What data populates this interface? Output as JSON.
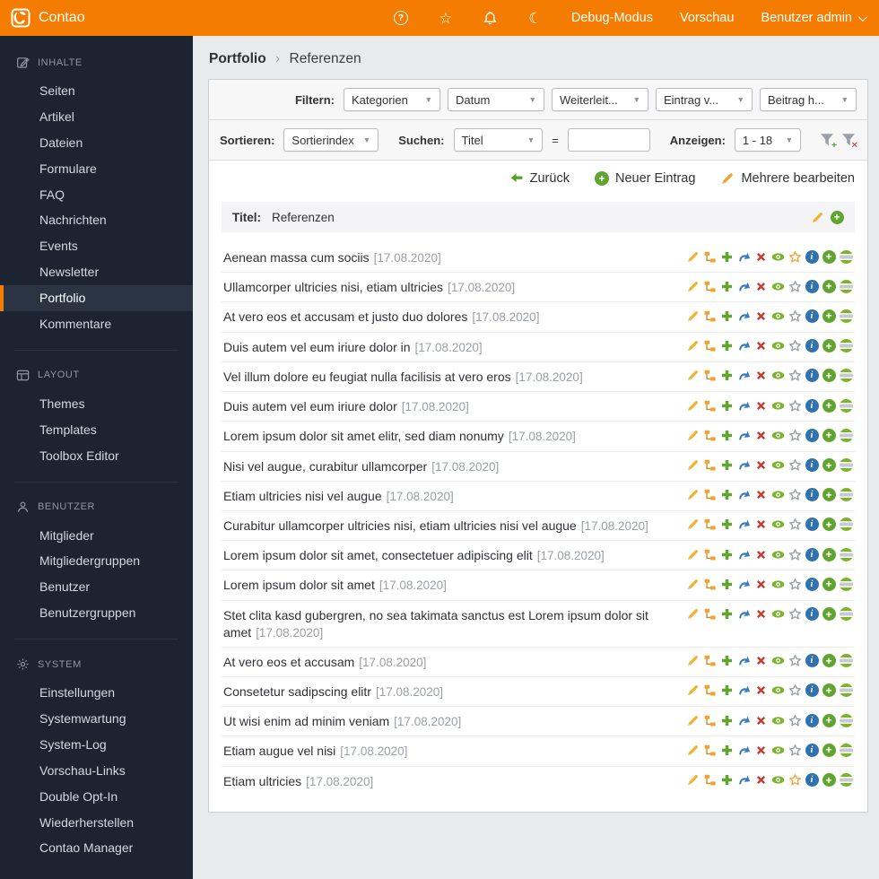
{
  "header": {
    "brand": "Contao",
    "icons": [
      {
        "name": "help-icon"
      },
      {
        "name": "favorites-star-icon"
      },
      {
        "name": "notifications-bell-icon"
      },
      {
        "name": "dark-mode-moon-icon"
      }
    ],
    "debug_link": "Debug-Modus",
    "preview_link": "Vorschau",
    "user_menu": "Benutzer admin"
  },
  "sidebar": {
    "sections": [
      {
        "label": "Inhalte",
        "icon": "edit-square",
        "active_index": 8,
        "items": [
          "Seiten",
          "Artikel",
          "Dateien",
          "Formulare",
          "FAQ",
          "Nachrichten",
          "Events",
          "Newsletter",
          "Portfolio",
          "Kommentare"
        ]
      },
      {
        "label": "Layout",
        "icon": "layout",
        "active_index": -1,
        "items": [
          "Themes",
          "Templates",
          "Toolbox Editor"
        ]
      },
      {
        "label": "Benutzer",
        "icon": "user",
        "active_index": -1,
        "items": [
          "Mitglieder",
          "Mitgliedergruppen",
          "Benutzer",
          "Benutzergruppen"
        ]
      },
      {
        "label": "System",
        "icon": "gear",
        "active_index": -1,
        "items": [
          "Einstellungen",
          "Systemwartung",
          "System-Log",
          "Vorschau-Links",
          "Double Opt-In",
          "Wiederherstellen",
          "Contao Manager"
        ]
      }
    ]
  },
  "main": {
    "breadcrumb": {
      "parent": "Portfolio",
      "separator": "›",
      "current": "Referenzen"
    },
    "filter_bar": {
      "label": "Filtern:",
      "selects": [
        "Kategorien",
        "Datum",
        "Weiterleit...",
        "Eintrag v...",
        "Beitrag h..."
      ]
    },
    "sort_bar": {
      "sort_label": "Sortieren:",
      "sort_value": "Sortierindex",
      "search_label": "Suchen:",
      "search_value": "Titel",
      "equals": "=",
      "search_input": "",
      "show_label": "Anzeigen:",
      "show_value": "1 - 18"
    },
    "actions": {
      "back": "Zurück",
      "new_entry": "Neuer Eintrag",
      "edit_multiple": "Mehrere bearbeiten"
    },
    "list_header": {
      "label": "Titel:",
      "value": "Referenzen"
    },
    "row_icons": [
      "edit",
      "children",
      "duplicate",
      "cut",
      "delete",
      "toggle-visibility",
      "feature",
      "show-details",
      "create-after",
      "toggle-dates"
    ],
    "rows": [
      {
        "title": "Aenean massa cum sociis",
        "date": "[17.08.2020]",
        "featured": true
      },
      {
        "title": "Ullamcorper ultricies nisi, etiam ultricies",
        "date": "[17.08.2020]",
        "featured": false
      },
      {
        "title": "At vero eos et accusam et justo duo dolores",
        "date": "[17.08.2020]",
        "featured": false
      },
      {
        "title": "Duis autem vel eum iriure dolor in",
        "date": "[17.08.2020]",
        "featured": false
      },
      {
        "title": "Vel illum dolore eu feugiat nulla facilisis at vero eros",
        "date": "[17.08.2020]",
        "featured": false
      },
      {
        "title": "Duis autem vel eum iriure dolor",
        "date": "[17.08.2020]",
        "featured": false
      },
      {
        "title": "Lorem ipsum dolor sit amet elitr, sed diam nonumy",
        "date": "[17.08.2020]",
        "featured": false
      },
      {
        "title": "Nisi vel augue, curabitur ullamcorper",
        "date": "[17.08.2020]",
        "featured": false
      },
      {
        "title": "Etiam ultricies nisi vel augue",
        "date": "[17.08.2020]",
        "featured": false
      },
      {
        "title": "Curabitur ullamcorper ultricies nisi, etiam ultricies nisi vel augue",
        "date": "[17.08.2020]",
        "featured": false
      },
      {
        "title": "Lorem ipsum dolor sit amet, consectetuer adipiscing elit",
        "date": "[17.08.2020]",
        "featured": false
      },
      {
        "title": "Lorem ipsum dolor sit amet",
        "date": "[17.08.2020]",
        "featured": false
      },
      {
        "title": "Stet clita kasd gubergren, no sea takimata sanctus est Lorem ipsum dolor sit amet",
        "date": "[17.08.2020]",
        "featured": false
      },
      {
        "title": "At vero eos et accusam",
        "date": "[17.08.2020]",
        "featured": false
      },
      {
        "title": "Consetetur sadipscing elitr",
        "date": "[17.08.2020]",
        "featured": false
      },
      {
        "title": "Ut wisi enim ad minim veniam",
        "date": "[17.08.2020]",
        "featured": false
      },
      {
        "title": "Etiam augue vel nisi",
        "date": "[17.08.2020]",
        "featured": false
      },
      {
        "title": "Etiam ultricies",
        "date": "[17.08.2020]",
        "featured": true
      }
    ]
  },
  "colors": {
    "accent_orange": "#f47c00",
    "green": "#61a430",
    "red": "#c43a31",
    "blue": "#2f72ad",
    "star_active": "#f2a63c",
    "sidebar_bg": "#1b2430"
  }
}
